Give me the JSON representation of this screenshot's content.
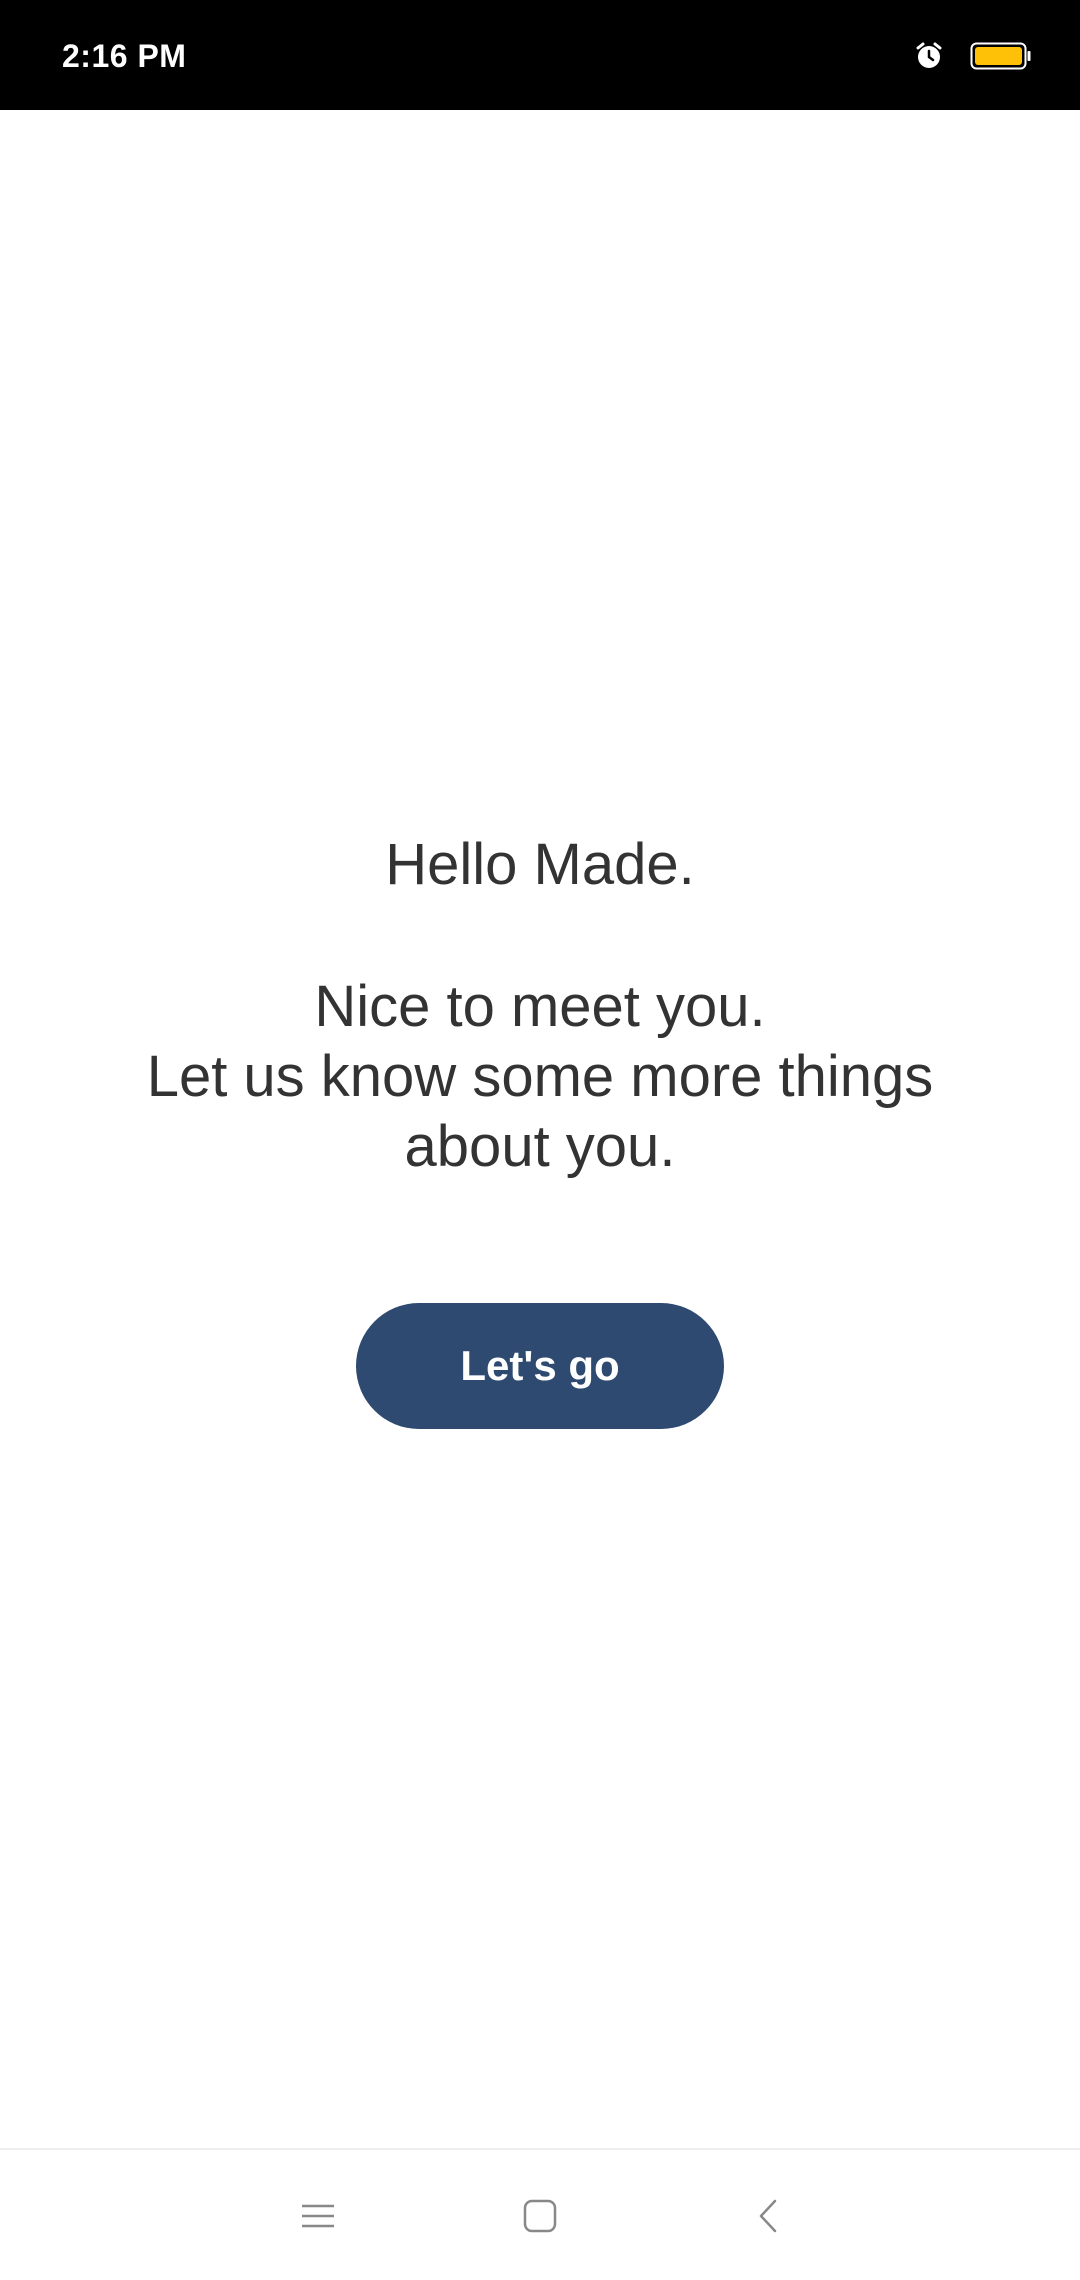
{
  "status_bar": {
    "time": "2:16 PM",
    "icons": [
      "alarm-icon",
      "battery-icon"
    ],
    "battery_color": "#ffc107"
  },
  "main": {
    "greeting": "Hello Made.",
    "message_lines": [
      "Nice to meet you.",
      "Let us know some more things",
      "about you."
    ],
    "primary_button": {
      "label": "Let's go",
      "color": "#2e4a70"
    }
  },
  "nav_bar": {
    "icons": [
      "menu-icon",
      "home-icon",
      "back-icon"
    ]
  }
}
